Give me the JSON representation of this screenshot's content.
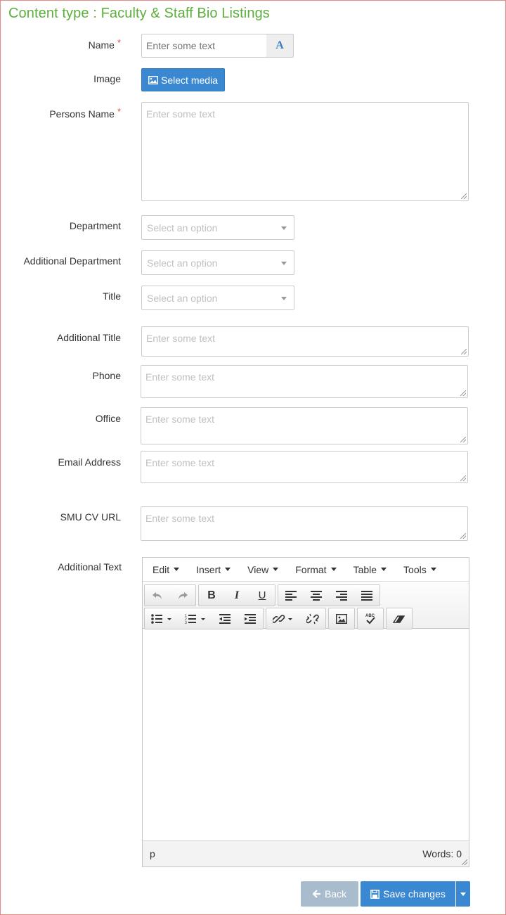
{
  "page": {
    "title": "Content type : Faculty & Staff Bio Listings"
  },
  "fields": {
    "name": {
      "label": "Name",
      "required_mark": "*",
      "placeholder": "Enter some text",
      "addon_icon": "font-icon",
      "addon_text": "A"
    },
    "image": {
      "label": "Image",
      "button_label": "Select media",
      "button_icon": "image-icon"
    },
    "persons_name": {
      "label": "Persons Name",
      "required_mark": "*",
      "placeholder": "Enter some text"
    },
    "department": {
      "label": "Department",
      "placeholder": "Select an option"
    },
    "additional_department": {
      "label": "Additional Department",
      "placeholder": "Select an option"
    },
    "title": {
      "label": "Title",
      "placeholder": "Select an option"
    },
    "additional_title": {
      "label": "Additional Title",
      "placeholder": "Enter some text"
    },
    "phone": {
      "label": "Phone",
      "placeholder": "Enter some text"
    },
    "office": {
      "label": "Office",
      "placeholder": "Enter some text"
    },
    "email": {
      "label": "Email Address",
      "placeholder": "Enter some text"
    },
    "cv_url": {
      "label": "SMU CV URL",
      "placeholder": "Enter some text"
    },
    "additional_text": {
      "label": "Additional Text"
    }
  },
  "editor": {
    "menus": [
      "Edit",
      "Insert",
      "View",
      "Format",
      "Table",
      "Tools"
    ],
    "status_path": "p",
    "word_count": "Words: 0",
    "toolbar_icons": [
      "undo-icon",
      "redo-icon",
      "bold-icon",
      "italic-icon",
      "underline-icon",
      "align-left-icon",
      "align-center-icon",
      "align-right-icon",
      "align-justify-icon",
      "bullet-list-icon",
      "numbered-list-icon",
      "outdent-icon",
      "indent-icon",
      "link-icon",
      "unlink-icon",
      "image-icon",
      "spellcheck-icon",
      "eraser-icon"
    ]
  },
  "actions": {
    "back_label": "Back",
    "save_label": "Save changes"
  },
  "colors": {
    "title": "#5cae3d",
    "primary": "#3a88d1",
    "back": "#a9bccd",
    "required": "#d9534f"
  }
}
